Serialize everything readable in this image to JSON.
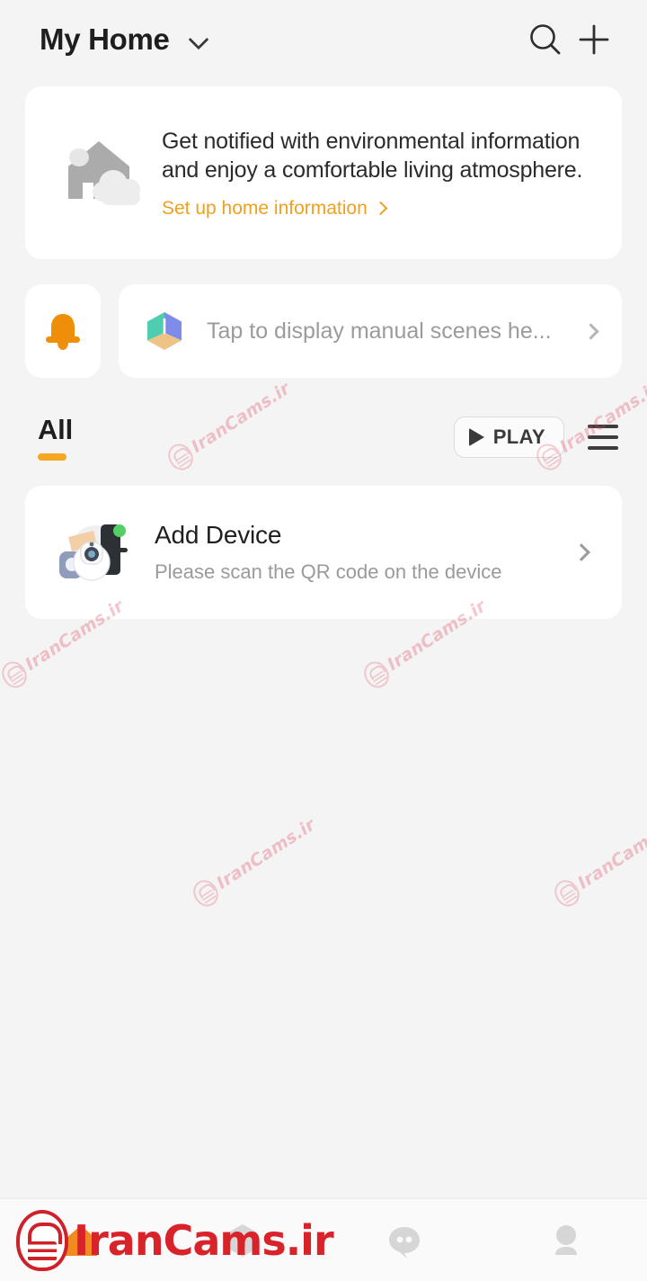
{
  "header": {
    "title": "My Home",
    "dropdown_icon": "chevron-down-icon",
    "search_icon": "search-icon",
    "add_icon": "plus-icon"
  },
  "banner": {
    "illustration": "house-cloud-icon",
    "line1": "Get notified with environmental information",
    "line2": "and enjoy a comfortable living atmosphere.",
    "link_label": "Set up home information",
    "link_chevron": "chevron-right-icon",
    "link_color": "#f0a020"
  },
  "scenes": {
    "bell_icon": "bell-icon",
    "bell_color": "#f08c00",
    "cube_icon": "scene-cube-icon",
    "placeholder": "Tap to display manual scenes he...",
    "chevron": "chevron-right-icon"
  },
  "tabs": {
    "items": [
      {
        "label": "All",
        "active": true
      }
    ],
    "play_label": "PLAY",
    "play_icon": "play-triangle-icon",
    "menu_icon": "hamburger-menu-icon",
    "accent_color": "#f5a623"
  },
  "add_device": {
    "illustration": "device-camera-lock-icon",
    "title": "Add Device",
    "subtitle": "Please scan the QR code on the device",
    "chevron": "chevron-right-icon"
  },
  "bottom_nav": {
    "items": [
      {
        "icon": "home-icon",
        "active": true,
        "color": "#f08c1e"
      },
      {
        "icon": "smart-hexagon-icon",
        "active": false,
        "color": "#d6d6d6"
      },
      {
        "icon": "chat-bubble-icon",
        "active": false,
        "color": "#d6d6d6"
      },
      {
        "icon": "profile-avatar-icon",
        "active": false,
        "color": "#d6d6d6"
      }
    ]
  },
  "watermark": {
    "text": "IranCams.ir",
    "logo": "irancams-logo-icon",
    "color": "#e0465a",
    "bar_text": "IranCams.ir",
    "bar_color": "#d8232a"
  },
  "theme": {
    "background": "#f4f4f4",
    "card": "#ffffff",
    "accent": "#f5a623",
    "text_primary": "#1f1f1f",
    "text_secondary": "#9a9a9a"
  }
}
